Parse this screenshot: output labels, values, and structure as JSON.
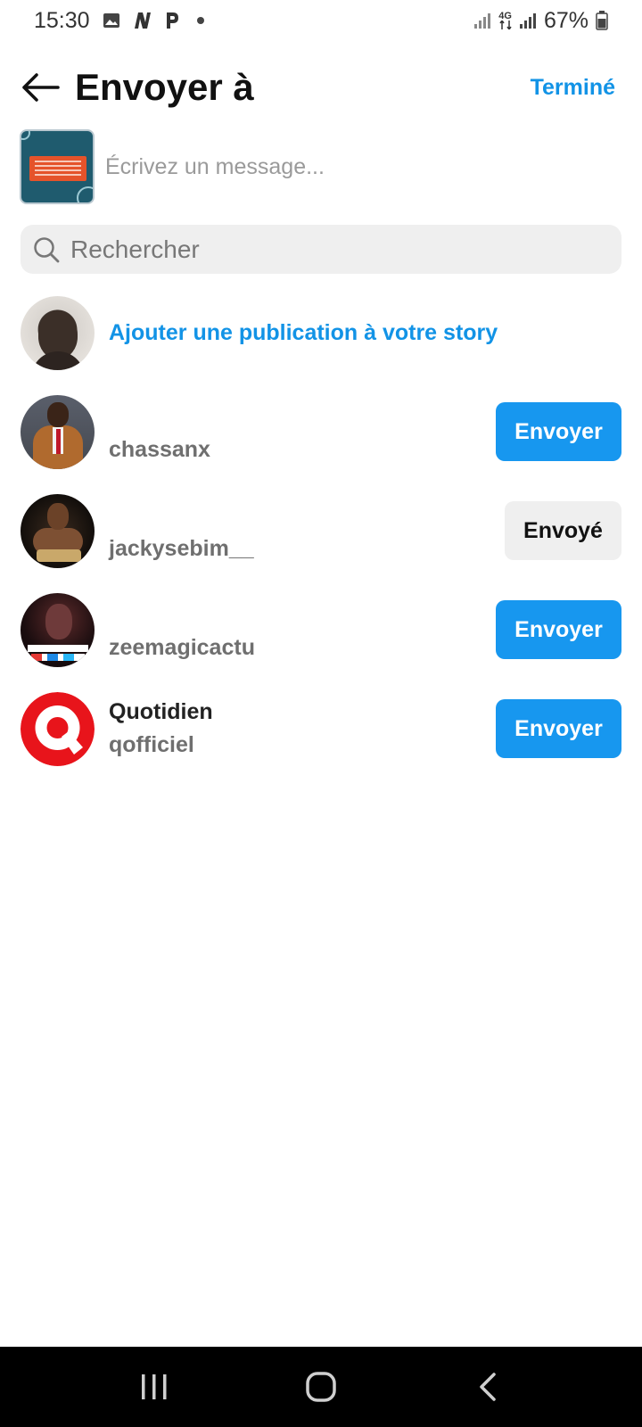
{
  "status_bar": {
    "time": "15:30",
    "network": "4G",
    "battery": "67%"
  },
  "header": {
    "title": "Envoyer à",
    "done_label": "Terminé"
  },
  "message": {
    "placeholder": "Écrivez un message..."
  },
  "search": {
    "placeholder": "Rechercher"
  },
  "story": {
    "label": "Ajouter une publication à votre story"
  },
  "recipients": [
    {
      "username": "chassanx",
      "display_name": "",
      "button_label": "Envoyer",
      "state": "send"
    },
    {
      "username": "jackysebim__",
      "display_name": "",
      "button_label": "Envoyé",
      "state": "sent"
    },
    {
      "username": "zeemagicactu",
      "display_name": "",
      "button_label": "Envoyer",
      "state": "send"
    },
    {
      "username": "qofficiel",
      "display_name": "Quotidien",
      "button_label": "Envoyer",
      "state": "send"
    }
  ],
  "colors": {
    "accent": "#1293e6",
    "send_button": "#1797ef",
    "sent_button": "#efefef",
    "search_bg": "#efefef",
    "brand_quotidien": "#e8141b"
  },
  "icons": {
    "back": "arrow-left-icon",
    "search": "search-icon",
    "nav_recents": "recents-icon",
    "nav_home": "home-icon",
    "nav_back": "chevron-left-icon"
  }
}
